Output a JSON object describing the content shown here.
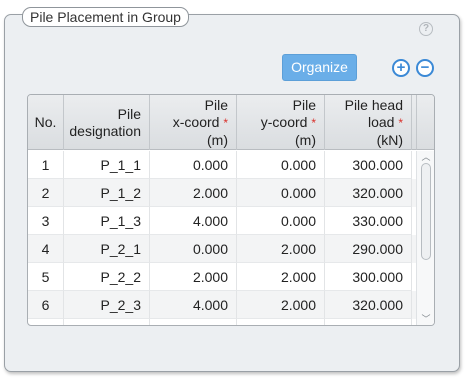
{
  "panel": {
    "title": "Pile Placement in Group",
    "help_icon": "?",
    "organize_label": "Organize",
    "add_icon": "+",
    "remove_icon": "−"
  },
  "table": {
    "headers": {
      "no": "No.",
      "designation_l1": "Pile",
      "designation_l2": "designation",
      "x_l1": "Pile",
      "x_l2": "x-coord",
      "x_l3": "(m)",
      "y_l1": "Pile",
      "y_l2": "y-coord",
      "y_l3": "(m)",
      "load_l1": "Pile head",
      "load_l2": "load",
      "load_l3": "(kN)",
      "required_mark": "*"
    },
    "rows": [
      {
        "no": "1",
        "designation": "P_1_1",
        "x": "0.000",
        "y": "0.000",
        "load": "300.000"
      },
      {
        "no": "2",
        "designation": "P_1_2",
        "x": "2.000",
        "y": "0.000",
        "load": "320.000"
      },
      {
        "no": "3",
        "designation": "P_1_3",
        "x": "4.000",
        "y": "0.000",
        "load": "330.000"
      },
      {
        "no": "4",
        "designation": "P_2_1",
        "x": "0.000",
        "y": "2.000",
        "load": "290.000"
      },
      {
        "no": "5",
        "designation": "P_2_2",
        "x": "2.000",
        "y": "2.000",
        "load": "300.000"
      },
      {
        "no": "6",
        "designation": "P_2_3",
        "x": "4.000",
        "y": "2.000",
        "load": "320.000"
      }
    ]
  },
  "scrollbar": {
    "up_icon": "chevron-up-icon",
    "down_icon": "chevron-down-icon"
  }
}
